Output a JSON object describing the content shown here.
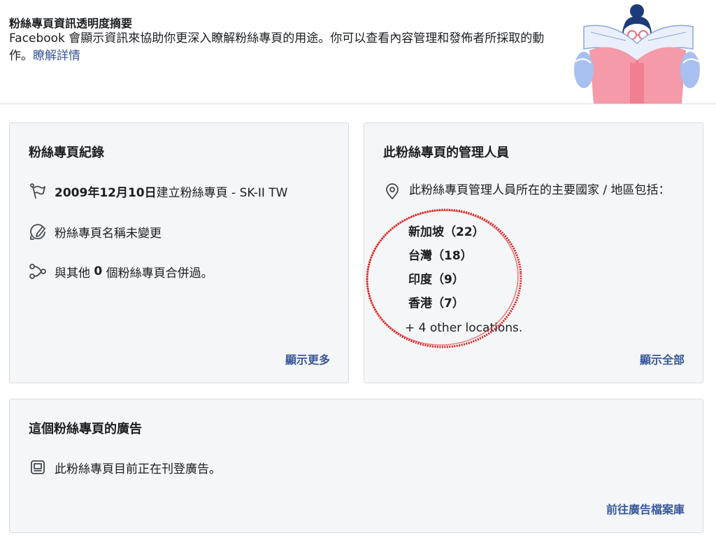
{
  "header": {
    "title": "粉絲專頁資訊透明度摘要",
    "description": "Facebook 會顯示資訊來協助你更深入瞭解粉絲專頁的用途。你可以查看內容管理和發佈者所採取的動作。",
    "learn_more": "瞭解詳情"
  },
  "history": {
    "title": "粉絲專頁紀錄",
    "created_date": "2009年12月10日",
    "created_text": "建立粉絲專頁 - SK-II TW",
    "name_text": "粉絲專頁名稱未變更",
    "merge_prefix": "與其他 ",
    "merge_count": "0",
    "merge_suffix": " 個粉絲專頁合併過。",
    "show_more": "顯示更多"
  },
  "managers": {
    "title": "此粉絲專頁的管理人員",
    "intro": "此粉絲專頁管理人員所在的主要國家 / 地區包括：",
    "locations": [
      "新加坡（22）",
      "台灣（18）",
      "印度（9）",
      "香港（7）"
    ],
    "more": "+ 4 other locations.",
    "show_all": "顯示全部"
  },
  "ads": {
    "title": "這個粉絲專頁的廣告",
    "status": "此粉絲專頁目前正在刊登廣告。",
    "library_link": "前往廣告檔案庫"
  },
  "colors": {
    "link": "#385898",
    "panel_bg": "#f5f6f7",
    "annotation": "#e02020"
  }
}
